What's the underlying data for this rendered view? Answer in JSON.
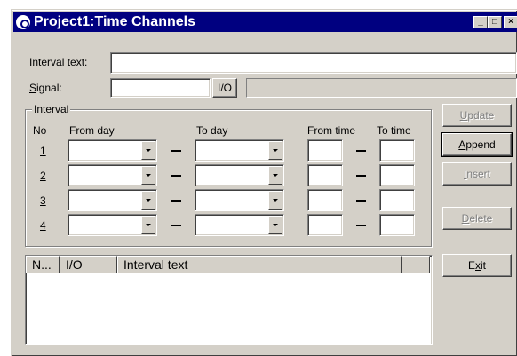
{
  "window": {
    "title": "Project1:Time Channels",
    "caption_buttons": [
      "_",
      "□",
      "×"
    ]
  },
  "fields": {
    "interval_text": {
      "label_accel": "I",
      "label_rest": "nterval text:",
      "value": ""
    },
    "signal": {
      "label_accel": "S",
      "label_rest": "ignal:",
      "value": "",
      "io_button": "I/O",
      "description": ""
    }
  },
  "interval_group": {
    "legend": "Interval",
    "headers": {
      "no": "No",
      "from_day": "From day",
      "to_day": "To day",
      "from_time": "From time",
      "to_time": "To time"
    },
    "rows": [
      {
        "no": "1",
        "from_day": "",
        "to_day": "",
        "from_time": "",
        "to_time": ""
      },
      {
        "no": "2",
        "from_day": "",
        "to_day": "",
        "from_time": "",
        "to_time": ""
      },
      {
        "no": "3",
        "from_day": "",
        "to_day": "",
        "from_time": "",
        "to_time": ""
      },
      {
        "no": "4",
        "from_day": "",
        "to_day": "",
        "from_time": "",
        "to_time": ""
      }
    ]
  },
  "buttons": {
    "update": {
      "accel": "U",
      "rest": "pdate",
      "enabled": false
    },
    "append": {
      "accel": "A",
      "rest": "ppend",
      "enabled": true
    },
    "insert": {
      "accel": "I",
      "rest": "nsert",
      "enabled": false
    },
    "delete": {
      "accel": "D",
      "rest": "elete",
      "enabled": false
    },
    "exit": {
      "pre": "E",
      "accel": "x",
      "rest": "it",
      "enabled": true
    }
  },
  "list": {
    "columns": [
      "N...",
      "I/O",
      "Interval text",
      ""
    ],
    "rows": []
  },
  "colors": {
    "titlebar": "#000080",
    "face": "#d4d0c8",
    "disabled_text": "#808080"
  },
  "icons": {
    "window": "app-icon",
    "dropdown": "chevron-down-icon"
  }
}
